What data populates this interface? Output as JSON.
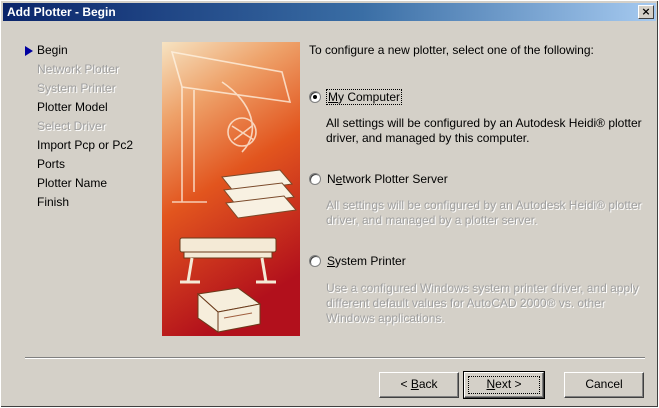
{
  "window": {
    "title": "Add Plotter - Begin",
    "close_glyph": "×"
  },
  "steps": [
    {
      "label": "Begin",
      "state": "current"
    },
    {
      "label": "Network Plotter",
      "state": "disabled"
    },
    {
      "label": "System Printer",
      "state": "disabled"
    },
    {
      "label": "Plotter Model",
      "state": "enabled"
    },
    {
      "label": "Select Driver",
      "state": "disabled"
    },
    {
      "label": "Import Pcp or Pc2",
      "state": "enabled"
    },
    {
      "label": "Ports",
      "state": "enabled"
    },
    {
      "label": "Plotter Name",
      "state": "enabled"
    },
    {
      "label": "Finish",
      "state": "enabled"
    }
  ],
  "prompt": "To configure a new plotter, select one of the following:",
  "options": [
    {
      "accel": "M",
      "label_rest": "y Computer",
      "selected": true,
      "description": "All settings will be configured by an Autodesk Heidi® plotter driver, and managed by this computer.",
      "description_enabled": true
    },
    {
      "accel_prefix": "N",
      "accel": "e",
      "label_rest": "twork Plotter Server",
      "selected": false,
      "description": "All settings will be configured by an Autodesk Heidi® plotter driver, and managed by a plotter server.",
      "description_enabled": false
    },
    {
      "accel": "S",
      "label_rest": "ystem Printer",
      "selected": false,
      "description": "Use a configured Windows system printer driver, and apply different default values for AutoCAD 2000® vs. other Windows applications.",
      "description_enabled": false
    }
  ],
  "buttons": {
    "back": {
      "prefix": "< ",
      "accel": "B",
      "rest": "ack"
    },
    "next": {
      "accel": "N",
      "rest": "ext >"
    },
    "cancel": {
      "label": "Cancel"
    }
  },
  "colors": {
    "dialog_bg": "#d4d0c8",
    "title_start": "#0a246a",
    "title_end": "#a6caf0",
    "illustration_top": "#f2d6b0",
    "illustration_mid": "#e2551e",
    "illustration_bottom": "#b2101c"
  }
}
